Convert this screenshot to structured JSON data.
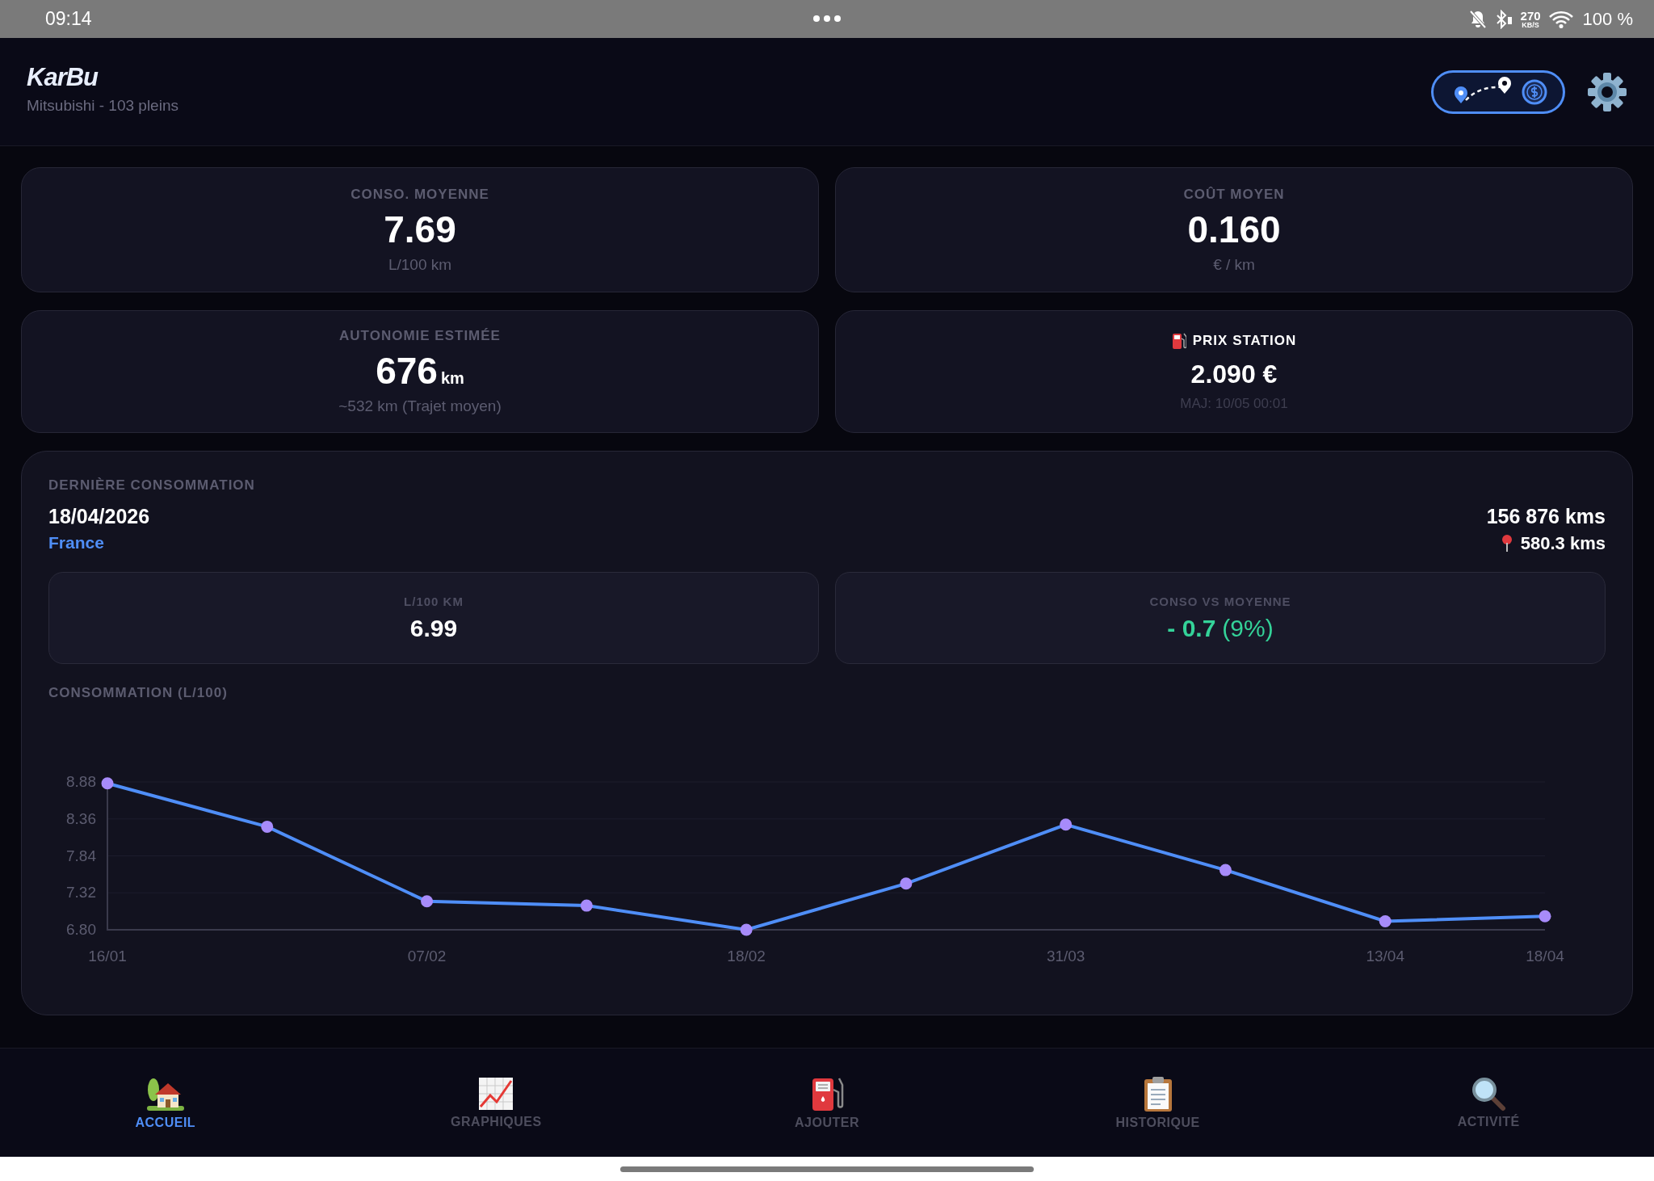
{
  "status_bar": {
    "time": "09:14",
    "speed": "270",
    "speed_unit": "KB/S",
    "battery": "100 %"
  },
  "header": {
    "logo": "KarBu",
    "subtitle": "Mitsubishi - 103 pleins"
  },
  "stats": [
    {
      "kind": "plain",
      "label": "CONSO. MOYENNE",
      "value": "7.69",
      "sub": "L/100 km"
    },
    {
      "kind": "plain",
      "label": "COÛT MOYEN",
      "value": "0.160",
      "sub": "€ / km"
    },
    {
      "kind": "unit",
      "label": "AUTONOMIE ESTIMÉE",
      "value": "676",
      "unit": "km",
      "sub": "~532 km (Trajet moyen)"
    },
    {
      "kind": "pump",
      "label": "PRIX STATION",
      "value": "2.090 €",
      "sub": "MAJ: 10/05 00:01"
    }
  ],
  "last": {
    "title": "DERNIÈRE CONSOMMATION",
    "date": "18/04/2026",
    "country": "France",
    "odometer": "156 876 kms",
    "trip": "580.3 kms",
    "metrics": [
      {
        "kind": "plain",
        "label": "L/100 KM",
        "value": "6.99"
      },
      {
        "kind": "delta",
        "label": "CONSO VS MOYENNE",
        "value": "- 0.7",
        "percent": "(9%)"
      }
    ],
    "chart_title": "CONSOMMATION (L/100)",
    "chart_data": {
      "type": "line",
      "categories": [
        "16/01",
        null,
        "07/02",
        null,
        "18/02",
        null,
        "31/03",
        null,
        "13/04",
        "18/04"
      ],
      "grid": true,
      "series": [
        {
          "color": "#4f8ef7",
          "marker": true,
          "values": [
            8.86,
            8.25,
            7.2,
            7.14,
            6.8,
            7.45,
            8.28,
            7.64,
            6.92,
            6.99
          ]
        }
      ],
      "ylim": [
        6.8,
        8.88
      ],
      "yticks": [
        {
          "value": 6.8,
          "label": "6.80"
        },
        {
          "value": 7.32,
          "label": "7.32"
        },
        {
          "value": 7.84,
          "label": "7.84"
        },
        {
          "value": 8.36,
          "label": "8.36"
        },
        {
          "value": 8.88,
          "label": "8.88"
        }
      ]
    }
  },
  "nav": [
    {
      "kind": "home",
      "label": "ACCUEIL",
      "selected": true
    },
    {
      "kind": "chart",
      "label": "GRAPHIQUES",
      "selected": false
    },
    {
      "kind": "pump",
      "label": "AJOUTER",
      "selected": false
    },
    {
      "kind": "clipboard",
      "label": "HISTORIQUE",
      "selected": false
    },
    {
      "kind": "search",
      "label": "ACTIVITÉ",
      "selected": false
    }
  ]
}
